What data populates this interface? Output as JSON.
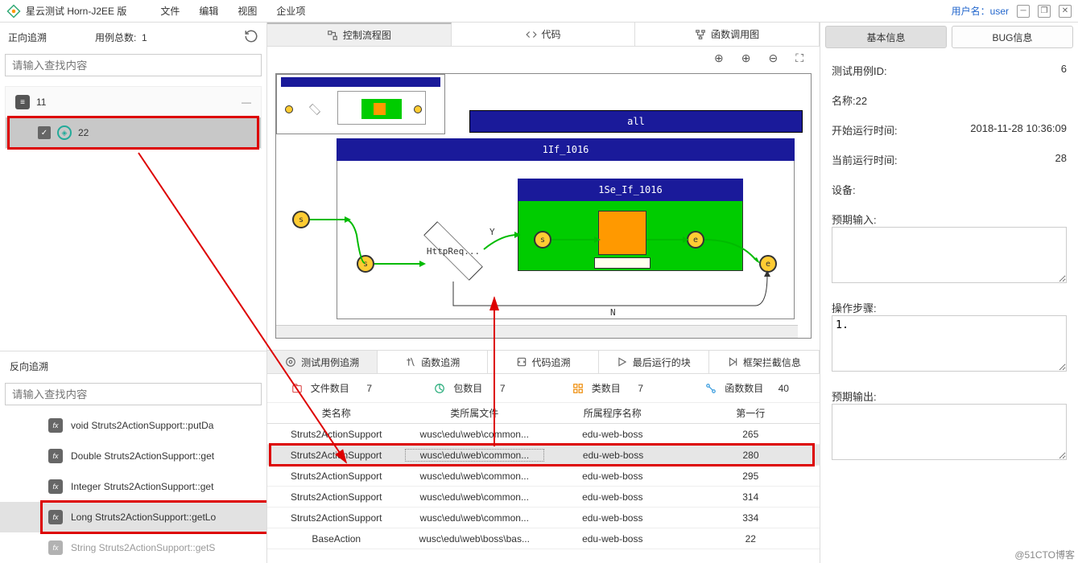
{
  "app": {
    "title": "星云测试 Horn-J2EE 版"
  },
  "menu": {
    "file": "文件",
    "edit": "编辑",
    "view": "视图",
    "enterprise": "企业项"
  },
  "user": {
    "label": "用户名：",
    "name": "user"
  },
  "left": {
    "forward_trace": "正向追溯",
    "case_count_label": "用例总数:",
    "case_count": "1",
    "search_placeholder": "请输入查找内容",
    "tree_parent": "11",
    "tree_child": "22",
    "backward_trace": "反向追溯",
    "fns": [
      "void Struts2ActionSupport::putDa",
      "Double Struts2ActionSupport::get",
      "Integer Struts2ActionSupport::get",
      "Long Struts2ActionSupport::getLo",
      "String Struts2ActionSupport::getS"
    ]
  },
  "center": {
    "tabs": {
      "flow": "控制流程图",
      "code": "代码",
      "callgraph": "函数调用图"
    },
    "diagram": {
      "all": "all",
      "if": "1If_1016",
      "se": "1Se_If_1016",
      "diamond": "HttpReq...",
      "Y": "Y",
      "N": "N",
      "s": "s",
      "e": "e"
    },
    "lower_tabs": {
      "trace": "测试用例追溯",
      "fn": "函数追溯",
      "code": "代码追溯",
      "last": "最后运行的块",
      "frame": "框架拦截信息"
    },
    "stats": {
      "files_label": "文件数目",
      "files": "7",
      "pkgs_label": "包数目",
      "pkgs": "7",
      "classes_label": "类数目",
      "classes": "7",
      "funcs_label": "函数数目",
      "funcs": "40"
    },
    "table": {
      "headers": {
        "cls": "类名称",
        "file": "类所属文件",
        "proc": "所属程序名称",
        "line": "第一行"
      },
      "rows": [
        {
          "cls": "Struts2ActionSupport",
          "file": "wusc\\edu\\web\\common...",
          "proc": "edu-web-boss",
          "line": "265"
        },
        {
          "cls": "Struts2ActionSupport",
          "file": "wusc\\edu\\web\\common...",
          "proc": "edu-web-boss",
          "line": "280"
        },
        {
          "cls": "Struts2ActionSupport",
          "file": "wusc\\edu\\web\\common...",
          "proc": "edu-web-boss",
          "line": "295"
        },
        {
          "cls": "Struts2ActionSupport",
          "file": "wusc\\edu\\web\\common...",
          "proc": "edu-web-boss",
          "line": "314"
        },
        {
          "cls": "Struts2ActionSupport",
          "file": "wusc\\edu\\web\\common...",
          "proc": "edu-web-boss",
          "line": "334"
        },
        {
          "cls": "BaseAction",
          "file": "wusc\\edu\\web\\boss\\bas...",
          "proc": "edu-web-boss",
          "line": "22"
        }
      ]
    }
  },
  "right": {
    "tabs": {
      "basic": "基本信息",
      "bug": "BUG信息"
    },
    "test_id_label": "测试用例ID:",
    "test_id": "6",
    "name_label": "名称:",
    "name": "22",
    "start_label": "开始运行时间:",
    "start": "2018-11-28 10:36:09",
    "runtime_label": "当前运行时间:",
    "runtime": "28",
    "device_label": "设备:",
    "expect_in_label": "预期输入:",
    "steps_label": "操作步骤:",
    "steps_text": "1.",
    "expect_out_label": "预期输出:"
  },
  "watermark": "@51CTO博客"
}
